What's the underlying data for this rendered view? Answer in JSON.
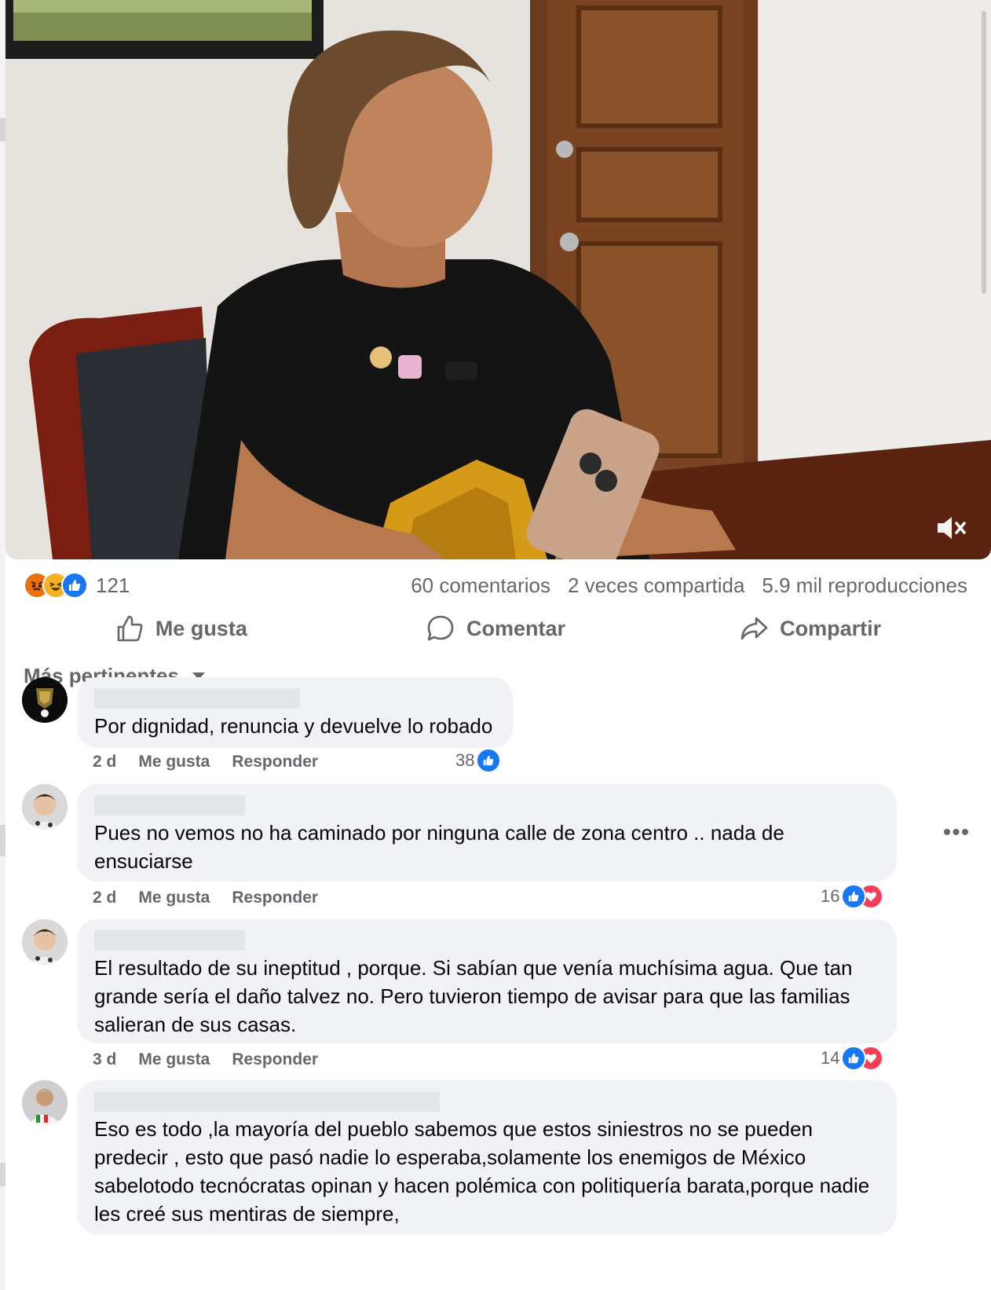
{
  "post": {
    "reaction_count": "121",
    "reaction_types": [
      "angry",
      "haha",
      "like"
    ],
    "comments_count": "60 comentarios",
    "shares_count": "2 veces compartida",
    "views_count": "5.9 mil reproducciones"
  },
  "actions": {
    "like": "Me gusta",
    "comment": "Comentar",
    "share": "Compartir"
  },
  "sort": {
    "label": "Más pertinentes"
  },
  "comments": [
    {
      "text": "Por dignidad, renuncia y devuelve lo robado",
      "age": "2 d",
      "like_label": "Me gusta",
      "reply_label": "Responder",
      "reactions": "38",
      "reaction_types": [
        "like"
      ]
    },
    {
      "text": "Pues no vemos no ha caminado por ninguna calle de zona centro .. nada de ensuciarse",
      "age": "2 d",
      "like_label": "Me gusta",
      "reply_label": "Responder",
      "reactions": "16",
      "reaction_types": [
        "like",
        "love"
      ]
    },
    {
      "text": "El resultado de su ineptitud , porque. Si sabían que venía muchísima agua. Que tan grande sería el daño talvez no. Pero tuvieron tiempo de avisar para que las familias salieran de sus casas.",
      "age": "3 d",
      "like_label": "Me gusta",
      "reply_label": "Responder",
      "reactions": "14",
      "reaction_types": [
        "like",
        "love"
      ]
    },
    {
      "text": "Eso es todo ,la mayoría del pueblo sabemos que estos siniestros no se pueden predecir , esto que pasó nadie lo esperaba,solamente los enemigos de México sabelotodo tecnócratas opinan y hacen polémica con politiquería barata,porque nadie les creé sus mentiras de siempre,"
    }
  ],
  "colors": {
    "like_blue": "#1877f2",
    "love_red": "#f33e58",
    "haha_yellow": "#f7b125",
    "angry_orange": "#e9710f",
    "secondary_text": "#65676b",
    "bubble_bg": "#f0f2f5"
  },
  "icons": [
    "mute-icon",
    "thumbs-up-icon",
    "comment-icon",
    "share-icon",
    "dropdown-caret-icon",
    "more-options-icon"
  ]
}
